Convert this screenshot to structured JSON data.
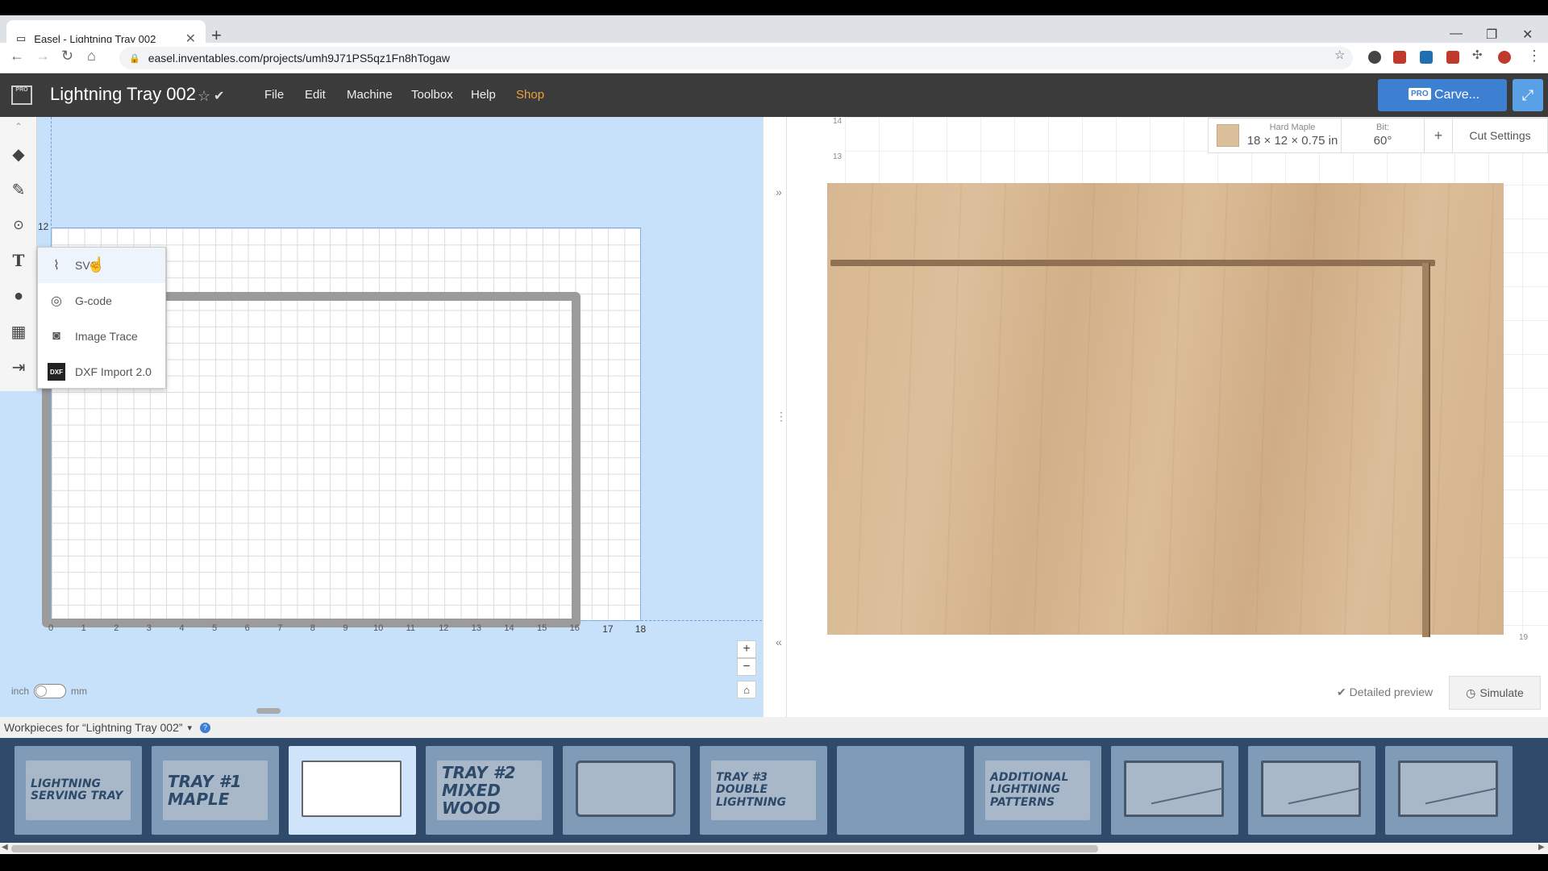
{
  "browser": {
    "tab_title": "Easel - Lightning Tray 002",
    "url": "easel.inventables.com/projects/umh9J71PS5qz1Fn8hTogaw"
  },
  "header": {
    "pro_logo": "PRO",
    "title": "Lightning Tray 002",
    "menu": [
      "File",
      "Edit",
      "Machine",
      "Toolbox",
      "Help",
      "Shop"
    ],
    "shop_color": "#e8a33c",
    "carve_pro_badge": "PRO",
    "carve_label": "Carve..."
  },
  "import_menu": {
    "items": [
      {
        "label": "SVG",
        "icon": "svg-icon"
      },
      {
        "label": "G-code",
        "icon": "gcode-icon"
      },
      {
        "label": "Image Trace",
        "icon": "camera-icon"
      },
      {
        "label": "DXF Import 2.0",
        "icon": "dxf-icon"
      }
    ]
  },
  "design_canvas": {
    "y_label_12": "12",
    "x_ticks": [
      "0",
      "1",
      "2",
      "3",
      "4",
      "5",
      "6",
      "7",
      "8",
      "9",
      "10",
      "11",
      "12",
      "13",
      "14",
      "15",
      "16",
      "17",
      "18"
    ],
    "unit_left": "inch",
    "unit_right": "mm"
  },
  "preview": {
    "material_label": "Hard Maple",
    "material_dims": "18 × 12 × 0.75 in",
    "bit_label": "Bit:",
    "bit_value": "60°",
    "plus": "+",
    "cut_settings": "Cut Settings",
    "y_ticks": [
      "14",
      "13"
    ],
    "x_tick_end": "19",
    "detailed_preview": "Detailed preview",
    "simulate": "Simulate"
  },
  "workpieces": {
    "header": "Workpieces for “Lightning Tray 002”",
    "help": "?",
    "cards": [
      {
        "text": "LIGHTNING SERVING TRAY"
      },
      {
        "text": "TRAY #1 MAPLE"
      },
      {
        "text": ""
      },
      {
        "text": "TRAY #2 MIXED WOOD"
      },
      {
        "text": ""
      },
      {
        "text": "TRAY #3 DOUBLE LIGHTNING"
      },
      {
        "text": ""
      },
      {
        "text": "ADDITIONAL LIGHTNING PATTERNS"
      },
      {
        "text": ""
      },
      {
        "text": ""
      },
      {
        "text": ""
      }
    ]
  }
}
